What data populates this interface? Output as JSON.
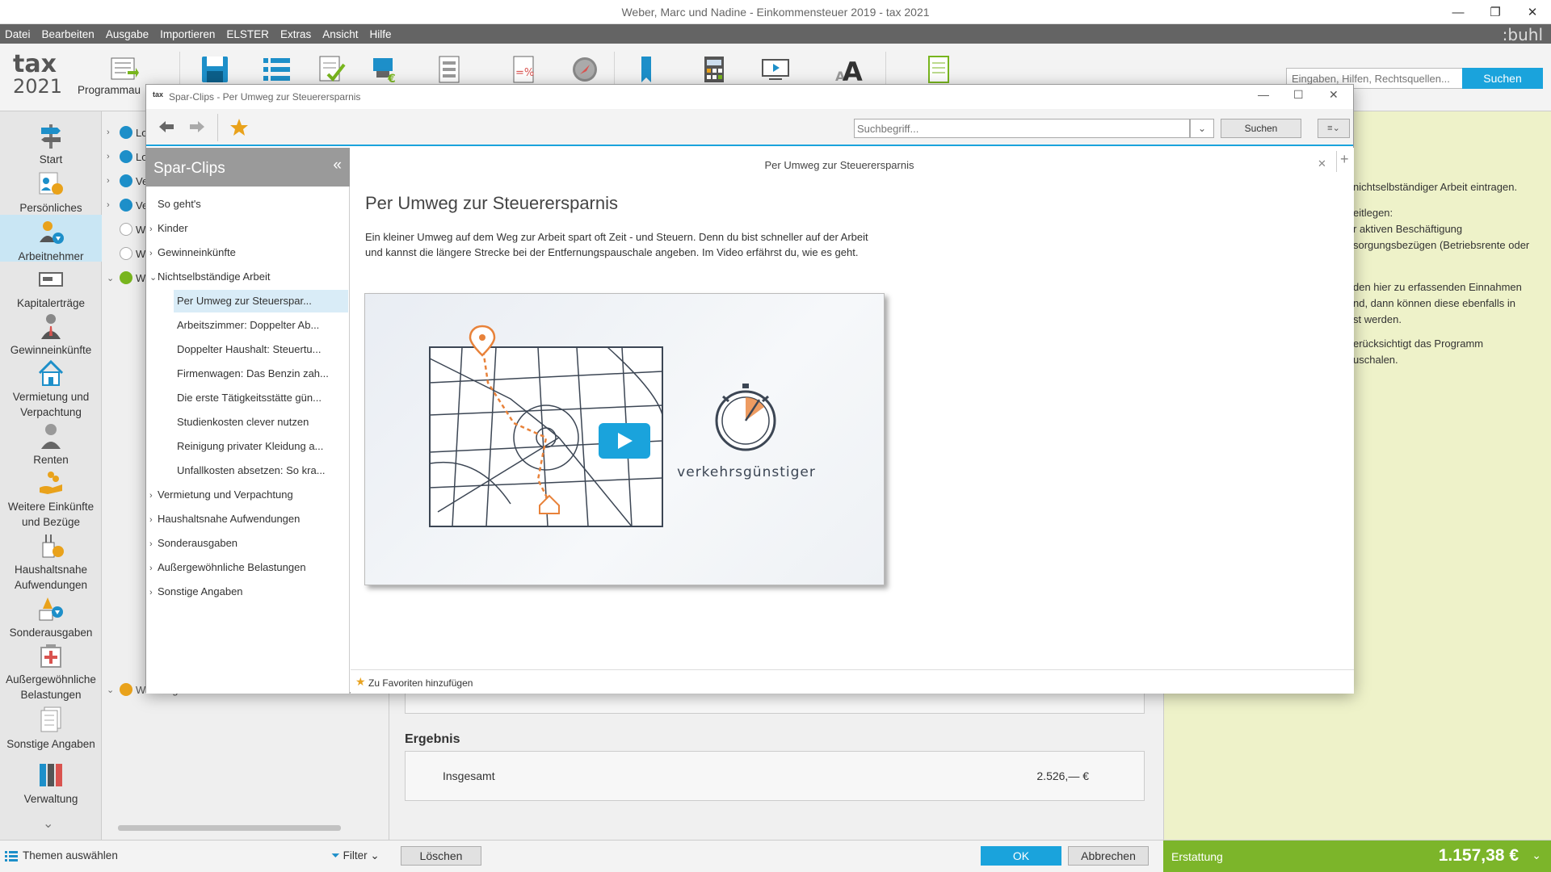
{
  "window": {
    "title": "Weber, Marc und Nadine - Einkommensteuer 2019 - tax 2021",
    "minimize": "—",
    "restore": "❐",
    "close": "✕"
  },
  "menu": {
    "items": [
      "Datei",
      "Bearbeiten",
      "Ausgabe",
      "Importieren",
      "ELSTER",
      "Extras",
      "Ansicht",
      "Hilfe"
    ],
    "brand": ":buhl"
  },
  "toolbar": {
    "logo_top": "tax",
    "logo_bottom": "2021",
    "label_program": "Programmau",
    "search_placeholder": "Eingaben, Hilfen, Rechtsquellen...",
    "search_button": "Suchen"
  },
  "leftnav": {
    "items": [
      {
        "label": "Start",
        "icon": "signpost-icon"
      },
      {
        "label": "Persönliches",
        "icon": "persons-icon"
      },
      {
        "label": "Arbeitnehmer",
        "icon": "employee-icon"
      },
      {
        "label": "Kapitalerträge",
        "icon": "capital-icon"
      },
      {
        "label": "Gewinneinkünfte",
        "icon": "businessman-icon"
      },
      {
        "label": "Vermietung und\nVerpachtung",
        "icon": "house-icon"
      },
      {
        "label": "Renten",
        "icon": "pensioner-icon"
      },
      {
        "label": "Weitere Einkünfte\nund Bezüge",
        "icon": "hand-coins-icon"
      },
      {
        "label": "Haushaltsnahe\nAufwendungen",
        "icon": "household-icon"
      },
      {
        "label": "Sonderausgaben",
        "icon": "special-expenses-icon"
      },
      {
        "label": "Außergewöhnliche\nBelastungen",
        "icon": "first-aid-icon"
      },
      {
        "label": "Sonstige Angaben",
        "icon": "documents-icon"
      },
      {
        "label": "Verwaltung",
        "icon": "folders-icon"
      }
    ]
  },
  "tree": {
    "rows": [
      {
        "text": "Lo",
        "status": "blue"
      },
      {
        "text": "Lo",
        "status": "blue"
      },
      {
        "text": "Ve",
        "status": "blue"
      },
      {
        "text": "Ve",
        "status": "blue"
      },
      {
        "text": "W",
        "status": "empty"
      },
      {
        "text": "W",
        "status": "empty"
      },
      {
        "text": "W",
        "status": "green"
      },
      {
        "text": "Werbungskosten - Nadine",
        "status": "orange"
      }
    ]
  },
  "result": {
    "title": "Ergebnis",
    "total_label": "Insgesamt",
    "total_value": "2.526,— €"
  },
  "help": {
    "lines": [
      "nichtselbständiger Arbeit eintragen.",
      "eitlegen:",
      "r aktiven Beschäftigung",
      "sorgungsbezügen (Betriebsrente oder",
      "den hier zu erfassenden Einnahmen",
      "nd, dann können diese ebenfalls in",
      "st werden.",
      "erücksichtigt das Programm",
      "uschalen."
    ]
  },
  "bottombar": {
    "themes": "Themen auswählen",
    "filter": "Filter",
    "delete": "Löschen",
    "ok": "OK",
    "cancel": "Abbrechen",
    "refund_label": "Erstattung",
    "refund_value": "1.157,38 €"
  },
  "dialog": {
    "icon_text": "tax",
    "title": "Spar-Clips - Per Umweg zur Steuerersparnis",
    "search_placeholder": "Suchbegriff...",
    "search_button": "Suchen",
    "sidebar_title": "Spar-Clips",
    "sidebar_collapse": "«",
    "sidebar_items": [
      {
        "label": "So geht's",
        "level": 0,
        "arrow": ""
      },
      {
        "label": "Kinder",
        "level": 0,
        "arrow": "›"
      },
      {
        "label": "Gewinneinkünfte",
        "level": 0,
        "arrow": "›"
      },
      {
        "label": "Nichtselbständige Arbeit",
        "level": 0,
        "arrow": "⌄"
      },
      {
        "label": "Per Umweg zur Steuerspar...",
        "level": 1,
        "selected": true
      },
      {
        "label": "Arbeitszimmer: Doppelter Ab...",
        "level": 1
      },
      {
        "label": "Doppelter Haushalt: Steuertu...",
        "level": 1
      },
      {
        "label": "Firmenwagen: Das Benzin zah...",
        "level": 1
      },
      {
        "label": "Die erste Tätigkeitsstätte gün...",
        "level": 1
      },
      {
        "label": "Studienkosten clever nutzen",
        "level": 1
      },
      {
        "label": "Reinigung privater Kleidung a...",
        "level": 1
      },
      {
        "label": "Unfallkosten absetzen: So kra...",
        "level": 1
      },
      {
        "label": "Vermietung und Verpachtung",
        "level": 0,
        "arrow": "›"
      },
      {
        "label": "Haushaltsnahe Aufwendungen",
        "level": 0,
        "arrow": "›"
      },
      {
        "label": "Sonderausgaben",
        "level": 0,
        "arrow": "›"
      },
      {
        "label": "Außergewöhnliche Belastungen",
        "level": 0,
        "arrow": "›"
      },
      {
        "label": "Sonstige Angaben",
        "level": 0,
        "arrow": "›"
      }
    ],
    "tab_title": "Per Umweg zur Steuerersparnis",
    "article_title": "Per Umweg zur Steuerersparnis",
    "article_text": "Ein kleiner Umweg auf dem Weg zur Arbeit spart oft Zeit - und Steuern. Denn du bist schneller auf der Arbeit und kannst die längere Strecke bei der Entfernungspauschale angeben. Im Video erfährst du, wie es geht.",
    "video_caption": "verkehrsgünstiger",
    "favorites": "Zu Favoriten hinzufügen"
  },
  "colors": {
    "accent": "#1aa3dc",
    "refund": "#7cb52a",
    "help_bg": "#eef2c9",
    "route": "#e8823a"
  }
}
